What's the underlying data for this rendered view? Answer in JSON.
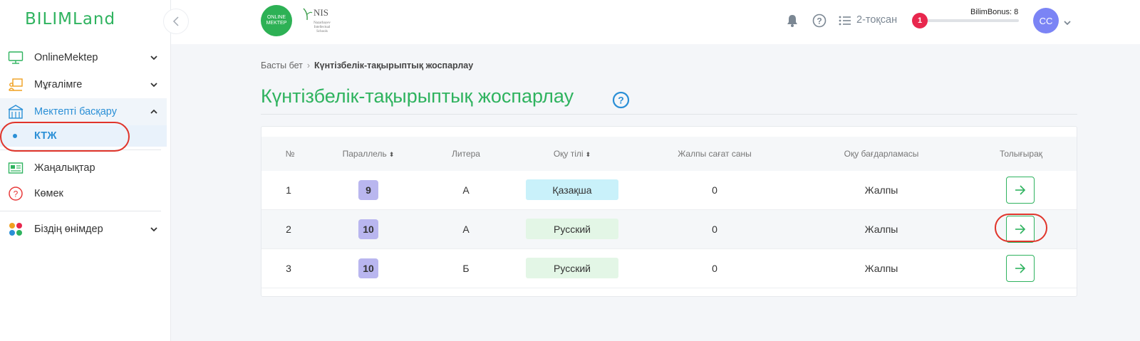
{
  "logo": {
    "text": "BILIMLand"
  },
  "sidebar": {
    "items": [
      {
        "label": "OnlineMektep"
      },
      {
        "label": "Мұғалімге"
      },
      {
        "label": "Мектепті басқару"
      },
      {
        "label": "КТЖ"
      },
      {
        "label": "Жаңалықтар"
      },
      {
        "label": "Көмек"
      },
      {
        "label": "Біздің өнімдер"
      }
    ]
  },
  "header": {
    "om_logo_line1": "ONLINE",
    "om_logo_line2": "MEKTEP",
    "nis_text": "NIS",
    "nis_small": "Nazarbayev Intellectual Schools",
    "quarter": "2-тоқсан",
    "bonus_label": "BilimBonus: 8",
    "bonus_badge": "1",
    "bonus_progress": 0,
    "avatar": "CC"
  },
  "breadcrumb": {
    "home": "Басты бет",
    "current": "Күнтізбелік-тақырыптық жоспарлау"
  },
  "page": {
    "title": "Күнтізбелік-тақырыптық жоспарлау"
  },
  "table": {
    "columns": {
      "num": "№",
      "parallel": "Параллель",
      "litera": "Литера",
      "lang": "Оқу тілі",
      "hours": "Жалпы сағат саны",
      "program": "Оқу бағдарламасы",
      "more": "Толығырақ"
    },
    "sort_glyph": "⬍",
    "rows": [
      {
        "num": "1",
        "parallel": "9",
        "litera": "А",
        "lang": "Қазақша",
        "hours": "0",
        "program": "Жалпы"
      },
      {
        "num": "2",
        "parallel": "10",
        "litera": "А",
        "lang": "Русский",
        "hours": "0",
        "program": "Жалпы"
      },
      {
        "num": "3",
        "parallel": "10",
        "litera": "Б",
        "lang": "Русский",
        "hours": "0",
        "program": "Жалпы"
      }
    ]
  },
  "colors": {
    "brand_green": "#2fb35f",
    "active_blue": "#2a8fd6",
    "annotation_red": "#e0352b",
    "kz_badge": "#c9f1fa",
    "ru_badge": "#e3f6e6",
    "grade_badge": "#b9b6ef"
  }
}
